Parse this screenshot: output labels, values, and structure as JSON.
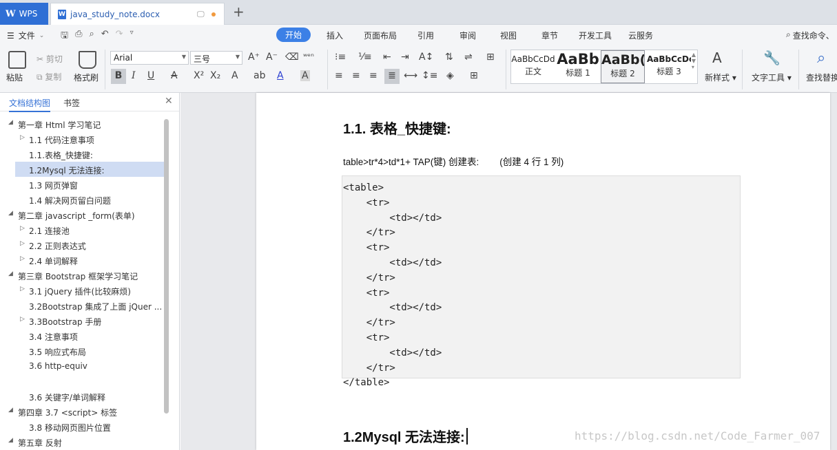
{
  "tabs": {
    "app": "WPS",
    "doc": "java_study_note.docx",
    "plus": "+"
  },
  "menu": {
    "file": "文件",
    "tabs": [
      "开始",
      "插入",
      "页面布局",
      "引用",
      "审阅",
      "视图",
      "章节",
      "开发工具",
      "云服务"
    ],
    "active_tab": "开始",
    "search_cmd": "查找命令、"
  },
  "ribbon": {
    "paste": "粘贴",
    "cut": "剪切",
    "copy": "复制",
    "format_painter": "格式刷",
    "font": "Arial",
    "size": "三号",
    "styles": [
      {
        "sample": "AaBbCcDd",
        "label": "正文"
      },
      {
        "sample": "AaBb",
        "label": "标题 1"
      },
      {
        "sample": "AaBb(",
        "label": "标题 2"
      },
      {
        "sample": "AaBbCcDc",
        "label": "标题 3"
      }
    ],
    "new_style": "新样式",
    "text_tools": "文字工具",
    "find_replace": "查找替换"
  },
  "sidebar": {
    "tab_outline": "文档结构图",
    "tab_bookmark": "书签",
    "items": [
      {
        "text": "第一章  Html 学习笔记",
        "level": 0,
        "arrow": "◢"
      },
      {
        "text": "1.1 代码注意事项",
        "level": 1,
        "arrow": "▷"
      },
      {
        "text": "1.1.表格_快捷键:",
        "level": 1,
        "arrow": ""
      },
      {
        "text": "1.2Mysql 无法连接:",
        "level": 1,
        "arrow": ""
      },
      {
        "text": "1.3 网页弹窗",
        "level": 1,
        "arrow": ""
      },
      {
        "text": "1.4 解决网页留白问题",
        "level": 1,
        "arrow": ""
      },
      {
        "text": "第二章    javascript _form(表单)",
        "level": 0,
        "arrow": "◢"
      },
      {
        "text": "2.1 连接池",
        "level": 1,
        "arrow": "▷"
      },
      {
        "text": "2.2 正则表达式",
        "level": 1,
        "arrow": "▷"
      },
      {
        "text": "2.4 单词解释",
        "level": 1,
        "arrow": "▷"
      },
      {
        "text": "第三章  Bootstrap 框架学习笔记",
        "level": 0,
        "arrow": "◢"
      },
      {
        "text": "3.1 jQuery 插件(比较麻烦)",
        "level": 1,
        "arrow": "▷"
      },
      {
        "text": "3.2Bootstrap 集成了上面 jQuer ...",
        "level": 1,
        "arrow": ""
      },
      {
        "text": "3.3Bootstrap 手册",
        "level": 1,
        "arrow": "▷"
      },
      {
        "text": "3.4  注意事项",
        "level": 1,
        "arrow": ""
      },
      {
        "text": "3.5 响应式布局",
        "level": 1,
        "arrow": ""
      },
      {
        "text": "3.6 http-equiv",
        "level": 1,
        "arrow": ""
      },
      {
        "text": "",
        "level": 1,
        "arrow": ""
      },
      {
        "text": "3.6 关键字/单词解释",
        "level": 1,
        "arrow": ""
      },
      {
        "text": "第四章  3.7 <script> 标签",
        "level": 0,
        "arrow": "◢"
      },
      {
        "text": "3.8 移动网页图片位置",
        "level": 1,
        "arrow": ""
      },
      {
        "text": "第五章  反射",
        "level": 0,
        "arrow": "◢"
      }
    ],
    "selected_index": 3
  },
  "document": {
    "heading1": "1.1. 表格_快捷键:",
    "para": "table>tr*4>td*1+ TAP(键)  创建表:",
    "para_note": "(创建 4 行 1 列)",
    "code": [
      "<table>",
      "    <tr>",
      "        <td></td>",
      "    </tr>",
      "    <tr>",
      "        <td></td>",
      "    </tr>",
      "    <tr>",
      "        <td></td>",
      "    </tr>",
      "    <tr>",
      "        <td></td>",
      "    </tr>",
      "</table>"
    ],
    "heading2": "1.2Mysql 无法连接:",
    "watermark": "https://blog.csdn.net/Code_Farmer_007"
  }
}
